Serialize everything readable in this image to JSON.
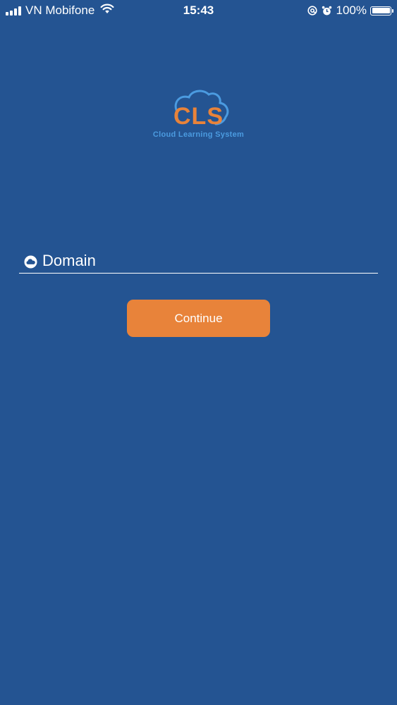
{
  "status_bar": {
    "carrier": "VN Mobifone",
    "time": "15:43",
    "battery_percent": "100%",
    "signal_bars": 4,
    "icons": [
      "signal-icon",
      "wifi-icon",
      "at-icon",
      "alarm-icon",
      "battery-icon"
    ]
  },
  "logo": {
    "mark": "CLS",
    "tagline": "Cloud Learning System",
    "icon": "cloud-icon"
  },
  "domain_field": {
    "placeholder": "Domain",
    "value": "",
    "icon": "cloud-icon"
  },
  "continue_button": {
    "label": "Continue"
  },
  "colors": {
    "background": "#245492",
    "accent": "#e8833a",
    "logo_blue": "#4b9be0",
    "text": "#ffffff"
  }
}
